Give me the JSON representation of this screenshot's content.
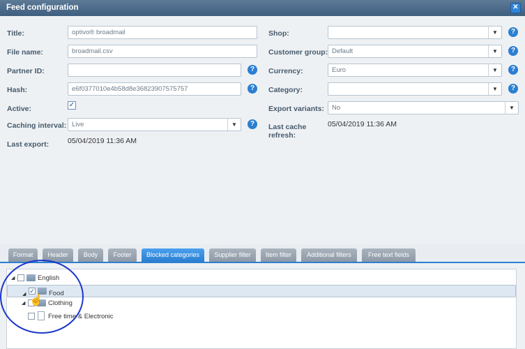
{
  "window": {
    "title": "Feed configuration",
    "close_glyph": "✕"
  },
  "left": {
    "title_label": "Title:",
    "title_value": "optivo® broadmail",
    "file_label": "File name:",
    "file_value": "broadmail.csv",
    "partner_label": "Partner ID:",
    "partner_value": "",
    "hash_label": "Hash:",
    "hash_value": "e6f0377010e4b58d8e36823907575757",
    "active_label": "Active:",
    "active_checked": true,
    "caching_label": "Caching interval:",
    "caching_value": "Live",
    "last_export_label": "Last export:",
    "last_export_value": "05/04/2019 11:36 AM"
  },
  "right": {
    "shop_label": "Shop:",
    "shop_value": "",
    "customer_label": "Customer group:",
    "customer_value": "Default",
    "currency_label": "Currency:",
    "currency_value": "Euro",
    "category_label": "Category:",
    "category_value": "",
    "variants_label": "Export variants:",
    "variants_value": "No",
    "cache_label_1": "Last cache",
    "cache_label_2": "refresh:",
    "cache_value": "05/04/2019 11:36 AM"
  },
  "help_glyph": "?",
  "arrow_glyph": "▼",
  "tabs": [
    "Format",
    "Header",
    "Body",
    "Footer",
    "Blocked categories",
    "Supplier filter",
    "Item filter",
    "Additional filters",
    "Free text fields"
  ],
  "active_tab": "Blocked categories",
  "tree": [
    {
      "label": "English",
      "type": "folder",
      "checked": false
    },
    {
      "label": "Food",
      "type": "folder",
      "checked": true
    },
    {
      "label": "Clothing",
      "type": "folder",
      "checked": false
    },
    {
      "label": "Free time & Electronic",
      "type": "doc",
      "checked": false
    }
  ],
  "colors": {
    "accent": "#2b7fd1",
    "titlebar": "#4a6989",
    "annotation": "#1b37c9"
  }
}
